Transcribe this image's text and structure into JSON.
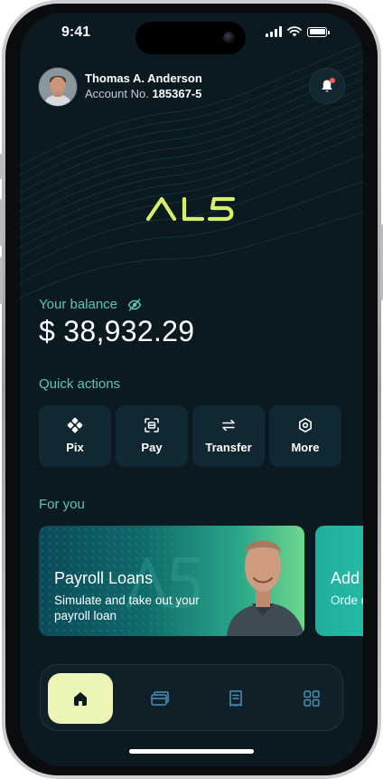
{
  "status_bar": {
    "time": "9:41"
  },
  "header": {
    "user_name": "Thomas A. Anderson",
    "account_prefix": "Account No.",
    "account_number": "185367-5"
  },
  "brand": {
    "logo_text": "AL5",
    "accent_color": "#d7f06a"
  },
  "balance": {
    "label": "Your balance",
    "amount": "$ 38,932.29"
  },
  "quick_actions": {
    "title": "Quick actions",
    "items": [
      {
        "label": "Pix",
        "icon": "pix-icon"
      },
      {
        "label": "Pay",
        "icon": "scan-pay-icon"
      },
      {
        "label": "Transfer",
        "icon": "transfer-arrows-icon"
      },
      {
        "label": "More",
        "icon": "more-hexagon-icon"
      }
    ]
  },
  "for_you": {
    "title": "For you",
    "cards": [
      {
        "title": "Payroll Loans",
        "description": "Simulate and take out your payroll loan"
      },
      {
        "title": "Add",
        "description": "Orde debit"
      }
    ]
  },
  "tab_bar": {
    "items": [
      {
        "icon": "home-icon",
        "active": true
      },
      {
        "icon": "cards-icon",
        "active": false
      },
      {
        "icon": "receipt-icon",
        "active": false
      },
      {
        "icon": "grid-icon",
        "active": false
      }
    ]
  },
  "colors": {
    "background": "#0b1a21",
    "teal_label": "#5fc4b2",
    "tab_active": "#ecf5b6",
    "notification_dot": "#ff5a4f"
  }
}
